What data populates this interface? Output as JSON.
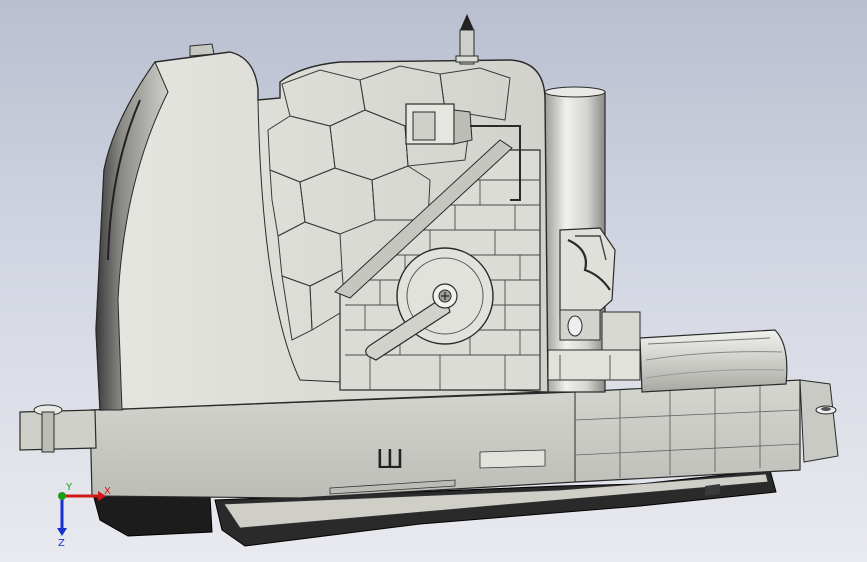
{
  "viewport": {
    "part_marking": "Ш",
    "colors": {
      "background_top": "#b9bfd0",
      "background_bottom": "#e9eaef",
      "body_fill": "#d8d8d2",
      "edge": "#2a2a2a",
      "dark_base": "#1c1c1c"
    }
  },
  "triad": {
    "x_label": "X",
    "y_label": "Y",
    "z_label": "Z",
    "colors": {
      "x": "#d01818",
      "y": "#18a018",
      "z": "#1830d0"
    }
  }
}
